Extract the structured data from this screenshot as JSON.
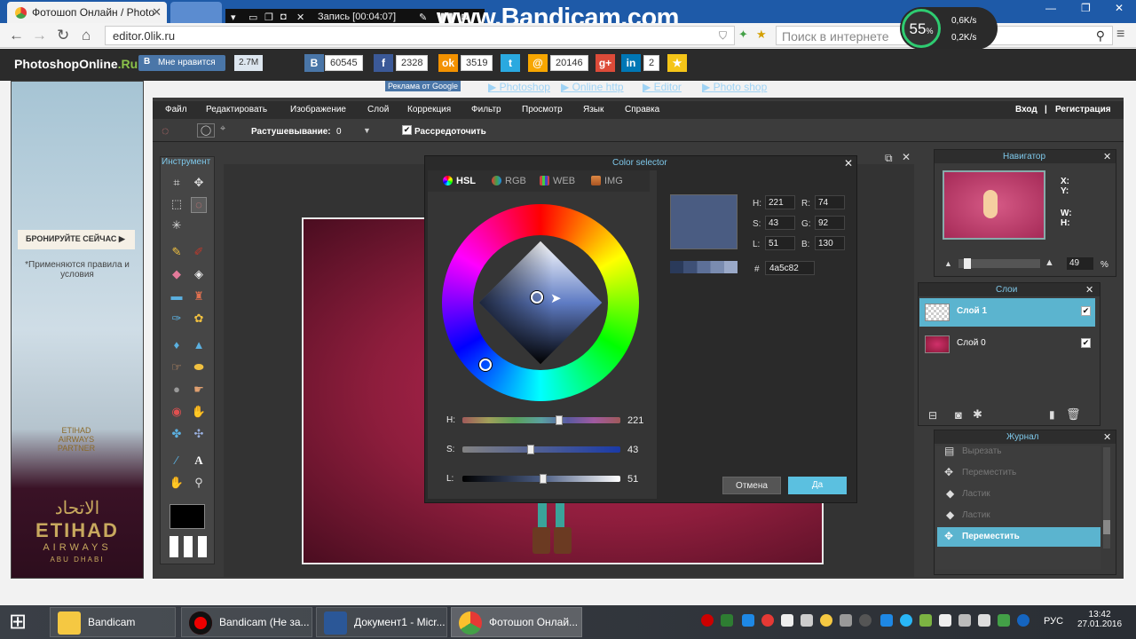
{
  "browser": {
    "tab_title": "Фотошоп Онлайн / Photo",
    "tab_close": "✕",
    "url": "editor.0lik.ru",
    "search_placeholder": "Поиск в интернете",
    "window_controls": [
      "—",
      "❐",
      "✕"
    ]
  },
  "recorder": {
    "record_label": "Запись [00:04:07]",
    "brand": "www.Bandicam.com",
    "cpu_percent": "55",
    "cpu_unit": "%",
    "up_speed": "0,6K/s",
    "down_speed": "0,2K/s"
  },
  "site": {
    "logo_a": "PhotoshopOnline",
    "logo_b": ".Ru",
    "vk_like": "Мне нравится",
    "vk_count": "2.7M",
    "social_counts": [
      "60545",
      "2328",
      "3519",
      "20146",
      "2"
    ],
    "ads_label": "Реклама от Google",
    "links": [
      "Photoshop",
      "Online http",
      "Editor",
      "Photo shop"
    ]
  },
  "banner": {
    "book_label": "БРОНИРУЙТЕ СЕЙЧАС",
    "rules": "*Применяются правила и условия",
    "partner_a": "ETIHAD",
    "partner_b": "AIRWAYS",
    "partner_c": "PARTNER",
    "arabic": "الاتحاد",
    "brand": "ETIHAD",
    "airways": "AIRWAYS",
    "city": "ABU DHABI"
  },
  "editor": {
    "menu": [
      "Файл",
      "Редактировать",
      "Изображение",
      "Слой",
      "Коррекция",
      "Фильтр",
      "Просмотр",
      "Язык",
      "Справка"
    ],
    "login": "Вход",
    "register": "Регистрация",
    "feather_label": "Растушевывание:",
    "feather_value": "0",
    "disperse_label": "Рассредоточить",
    "tools_title": "Инструмент"
  },
  "color_selector": {
    "title": "Color selector",
    "tabs": [
      "HSL",
      "RGB",
      "WEB",
      "IMG"
    ],
    "sliders": [
      {
        "label": "H:",
        "value": "221",
        "fraction": 0.61
      },
      {
        "label": "S:",
        "value": "43",
        "fraction": 0.43
      },
      {
        "label": "L:",
        "value": "51",
        "fraction": 0.51
      }
    ],
    "fields": {
      "H": "221",
      "S": "43",
      "L": "51",
      "R": "74",
      "G": "92",
      "B": "130"
    },
    "field_labels": {
      "H": "H:",
      "S": "S:",
      "L": "L:",
      "R": "R:",
      "G": "G:",
      "B": "B:"
    },
    "hex_label": "#",
    "hex": "4a5c82",
    "current_color": "#4a5c82",
    "cancel": "Отмена",
    "ok": "Да"
  },
  "navigator": {
    "title": "Навигатор",
    "x_label": "X:",
    "y_label": "Y:",
    "w_label": "W:",
    "h_label": "H:",
    "zoom": "49",
    "zoom_unit": "%"
  },
  "layers": {
    "title": "Слои",
    "items": [
      {
        "name": "Слой 1",
        "selected": true
      },
      {
        "name": "Слой 0",
        "selected": false
      }
    ]
  },
  "history": {
    "title": "Журнал",
    "items": [
      "Вырезать",
      "Переместить",
      "Ластик",
      "Ластик",
      "Переместить"
    ]
  },
  "taskbar": {
    "tasks": [
      "Bandicam",
      "Bandicam (Не за...",
      "Документ1 - Micr...",
      "Фотошоп Онлай..."
    ],
    "lang": "РУС",
    "time": "13:42",
    "date": "27.01.2016"
  }
}
